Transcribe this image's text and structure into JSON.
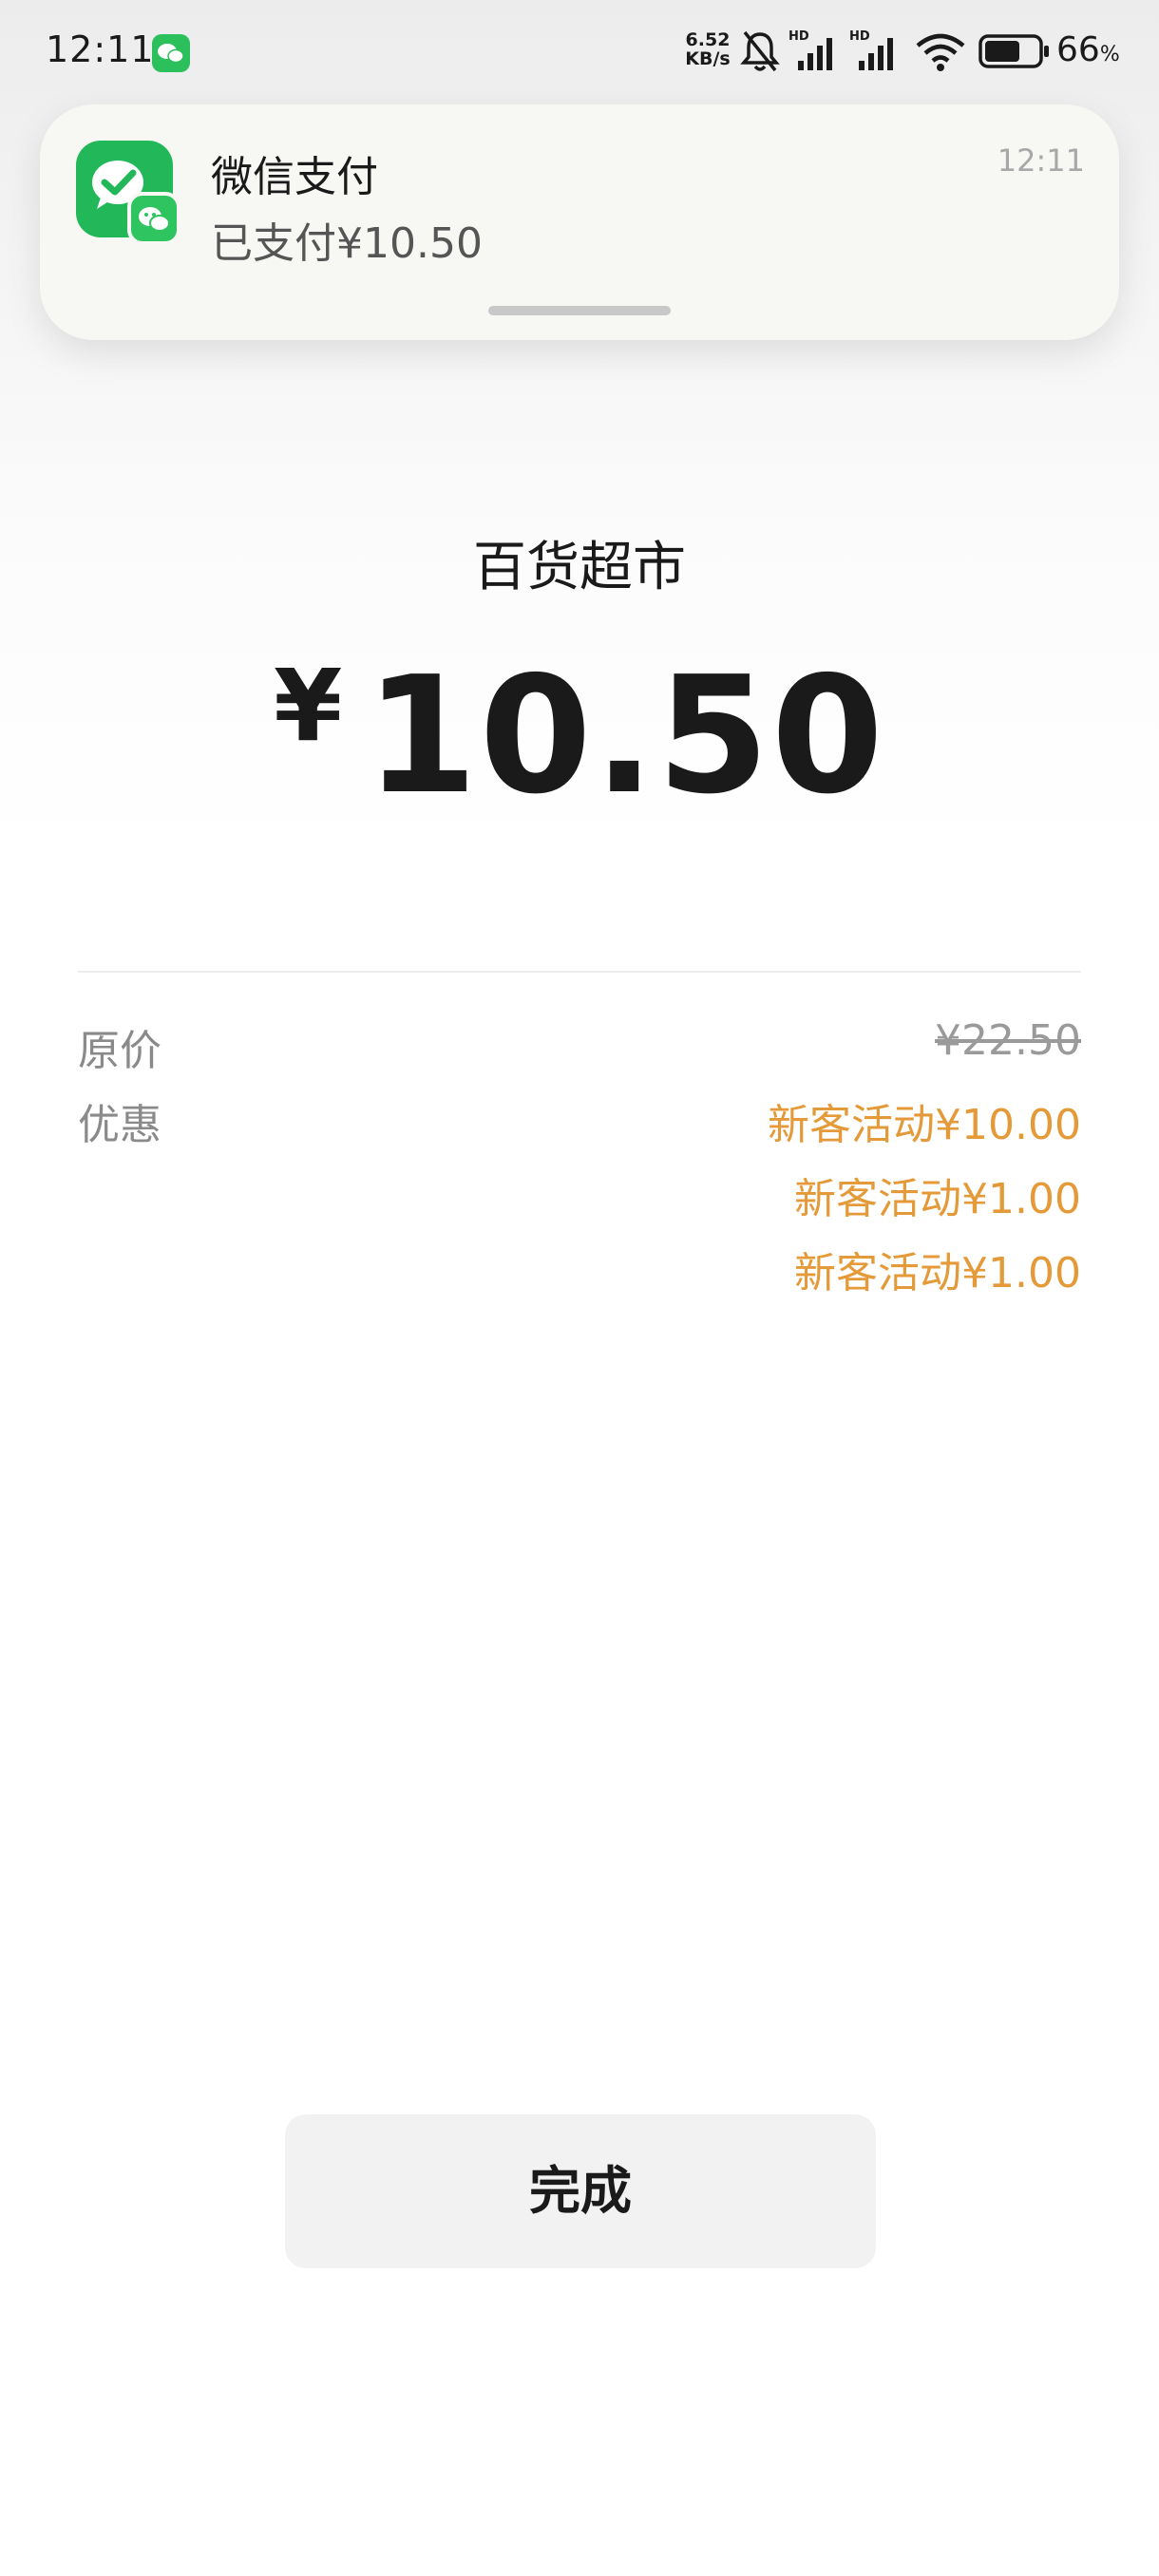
{
  "status_bar": {
    "time": "12:11",
    "net_speed_value": "6.52",
    "net_speed_unit": "KB/s",
    "battery_percent": "66",
    "battery_percent_sign": "%",
    "battery_level": 0.66,
    "icons": [
      "wechat-icon",
      "mute-bell-icon",
      "hd-signal-icon",
      "hd-signal-icon",
      "wifi-icon",
      "battery-icon"
    ]
  },
  "notification": {
    "app_name": "微信支付",
    "message": "已支付¥10.50",
    "time": "12:11",
    "icon": "wechat-pay-icon"
  },
  "payment": {
    "merchant": "百货超市",
    "currency_symbol": "¥",
    "amount": "10.50"
  },
  "details": {
    "original_price_label": "原价",
    "original_price": "¥22.50",
    "discount_label": "优惠",
    "discounts": [
      "新客活动¥10.00",
      "新客活动¥1.00",
      "新客活动¥1.00"
    ]
  },
  "actions": {
    "done_label": "完成"
  },
  "colors": {
    "accent_green": "#22b85a",
    "discount_orange": "#e49a38"
  }
}
